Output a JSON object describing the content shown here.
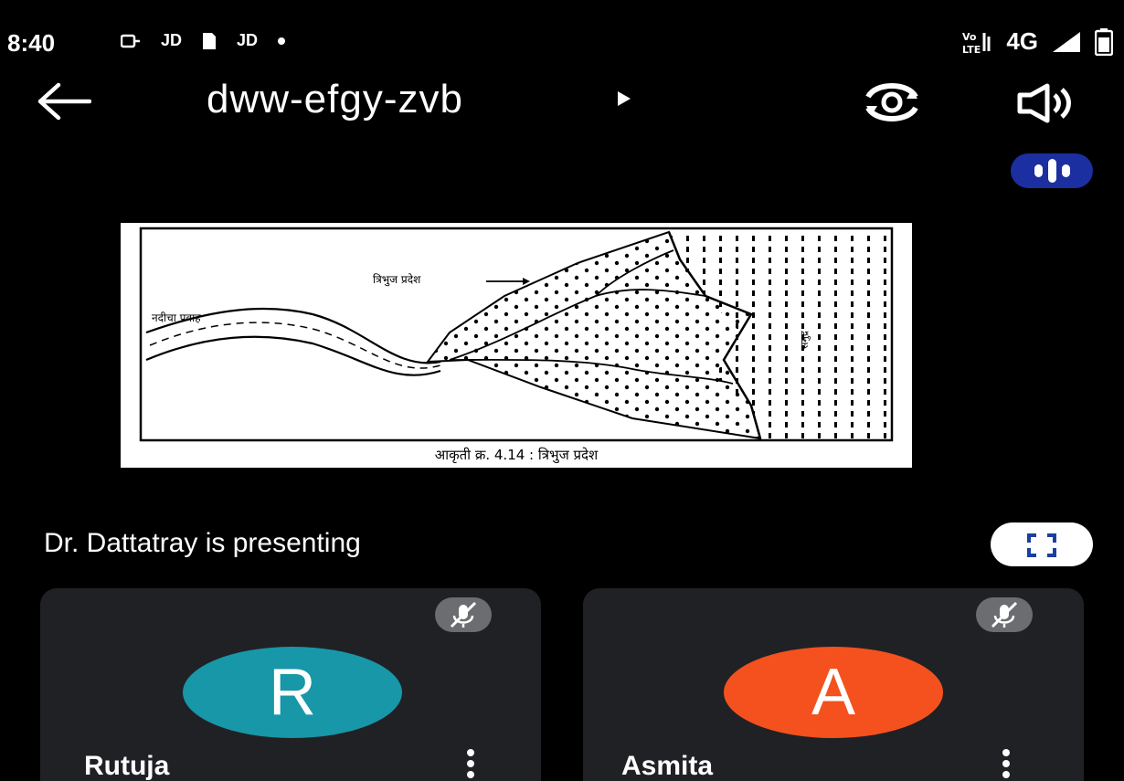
{
  "status_bar": {
    "time": "8:40",
    "left_icons": [
      "hotspot-icon",
      "jio-icon",
      "document-icon",
      "jio-icon",
      "dot-icon"
    ],
    "left_labels": [
      "JD",
      "JD"
    ],
    "network_label": "4G",
    "right_icons": [
      "volte-icon",
      "signal-icon",
      "battery-icon"
    ]
  },
  "toolbar": {
    "back_icon": "back-arrow-icon",
    "meeting_code": "dww-efgy-zvb",
    "expand_icon": "play-triangle-icon",
    "switch_camera_icon": "switch-camera-icon",
    "speaker_icon": "speaker-icon"
  },
  "voice_indicator_icon": "audio-bars-icon",
  "shared_slide": {
    "labels": {
      "river": "नदीचा प्रवाह",
      "delta": "त्रिभुज प्रदेश",
      "sea": "समुद्र"
    },
    "caption": "आकृती क्र. 4.14 : त्रिभुज प्रदेश"
  },
  "presenting_text": "Dr. Dattatray is presenting",
  "fullscreen_icon": "fullscreen-icon",
  "participants": [
    {
      "initial": "R",
      "name": "Rutuja",
      "color": "#1797a8",
      "muted": true
    },
    {
      "initial": "A",
      "name": "Asmita",
      "color": "#f4511e",
      "muted": true
    }
  ]
}
